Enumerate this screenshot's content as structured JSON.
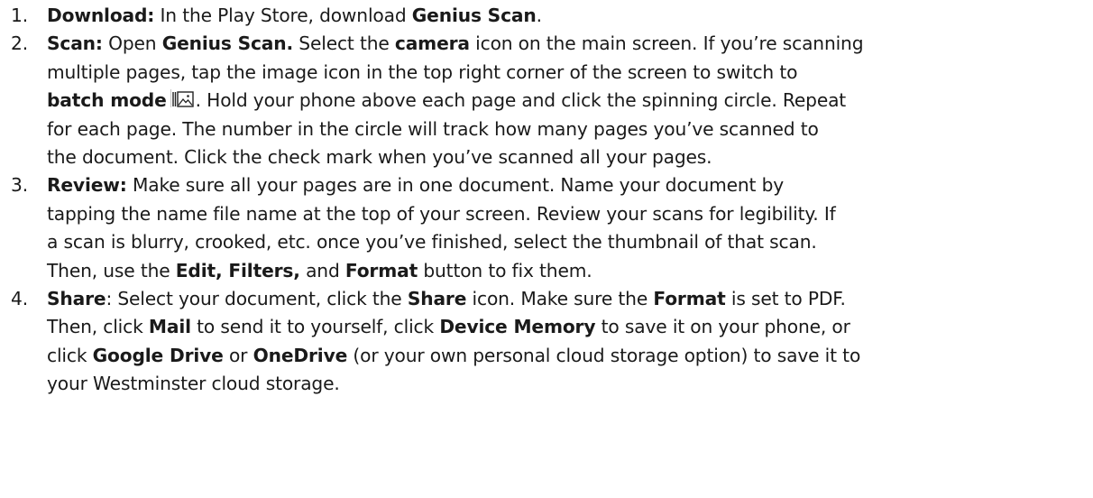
{
  "steps": [
    {
      "number": "1.",
      "lines": [
        [
          "Download:",
          " In the Play Store, download ",
          "Genius Scan",
          "."
        ]
      ]
    },
    {
      "number": "2.",
      "lines": [
        [
          "Scan:",
          " Open ",
          "Genius Scan.",
          " Select the ",
          "camera",
          " icon on the main screen. If you’re scanning"
        ],
        [
          "multiple pages, tap the image icon in the top right corner of the screen to switch to"
        ],
        [
          "batch mode",
          ". Hold your phone above each page and click the spinning circle. Repeat"
        ],
        [
          "for each page. The number in the circle will track how many pages you’ve scanned to"
        ],
        [
          "the document. Click the check mark when you’ve scanned all your pages."
        ]
      ]
    },
    {
      "number": "3.",
      "lines": [
        [
          "Review:",
          " Make sure all your pages are in one document. Name your document by"
        ],
        [
          "tapping the name file name at the top of your screen. Review your scans for legibility. If"
        ],
        [
          "a scan is blurry, crooked, etc. once you’ve finished, select the thumbnail of that scan."
        ],
        [
          "Then, use the ",
          "Edit, Filters,",
          " and ",
          "Format",
          " button to fix them."
        ]
      ]
    },
    {
      "number": "4.",
      "lines": [
        [
          "Share",
          ": Select your document, click the ",
          "Share",
          " icon. Make sure the ",
          "Format",
          " is set to PDF."
        ],
        [
          "Then, click ",
          "Mail",
          " to send it to yourself, click ",
          "Device Memory",
          " to save it on your phone, or"
        ],
        [
          "click ",
          "Google Drive",
          " or ",
          "OneDrive",
          " (or your own personal cloud storage option) to save it to"
        ],
        [
          "your Westminster cloud storage."
        ]
      ]
    }
  ],
  "icons": {
    "batch_mode": "batch-mode-image-icon"
  }
}
